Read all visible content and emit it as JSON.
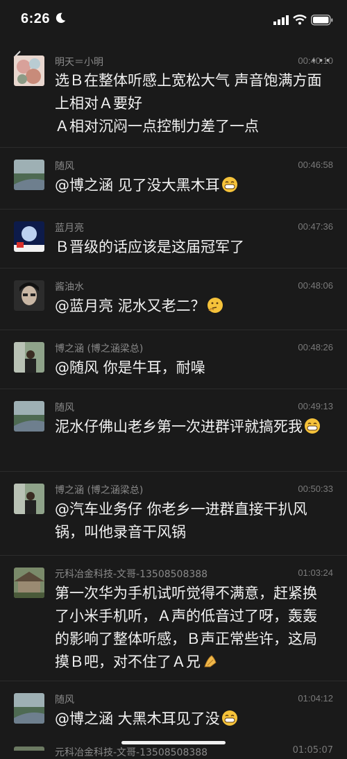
{
  "status": {
    "time": "6:26"
  },
  "comments": [
    {
      "name": "明天＝小明",
      "time": "00:40:10",
      "lines": [
        "选Ｂ在整体听感上宽松大气 声音饱满方面上相对Ａ要好",
        "Ａ相对沉闷一点控制力差了一点"
      ]
    },
    {
      "name": "随风",
      "time": "00:46:58",
      "text": "@博之涵 见了没大黑木耳",
      "emoji": "grin"
    },
    {
      "name": "蓝月亮",
      "time": "00:47:36",
      "text": "Ｂ晋级的话应该是这届冠军了"
    },
    {
      "name": "酱油水",
      "time": "00:48:06",
      "text": "@蓝月亮 泥水又老二？",
      "emoji": "thinking"
    },
    {
      "name": "博之涵 (博之涵梁总)",
      "time": "00:48:26",
      "text": "@随风 你是牛耳，耐噪"
    },
    {
      "name": "随风",
      "time": "00:49:13",
      "text": "泥水仔佛山老乡第一次进群评就搞死我",
      "emoji": "grin"
    },
    {
      "name": "博之涵 (博之涵梁总)",
      "time": "00:50:33",
      "text": "@汽车业务仔 你老乡一进群直接干扒风锅，叫他录音干风锅"
    },
    {
      "name": "元科冶金科技-文哥-13508508388",
      "time": "01:03:24",
      "text": "第一次华为手机试听觉得不满意，赶紧换了小米手机听，Ａ声的低音过了呀，轰轰的影响了整体听感，Ｂ声正常些许，这局摸Ｂ吧，对不住了Ａ兄",
      "emoji": "pray"
    },
    {
      "name": "随风",
      "time": "01:04:12",
      "text": "@博之涵 大黑木耳见了没",
      "emoji": "grin"
    }
  ],
  "partial": {
    "name": "元科冶金科技-文哥-13508508388",
    "time": "01:05:07"
  },
  "colors": {
    "background": "#1a1a1a",
    "name": "#8a8a8a",
    "text": "#f2f2f2",
    "divider": "#2c2c2c"
  }
}
